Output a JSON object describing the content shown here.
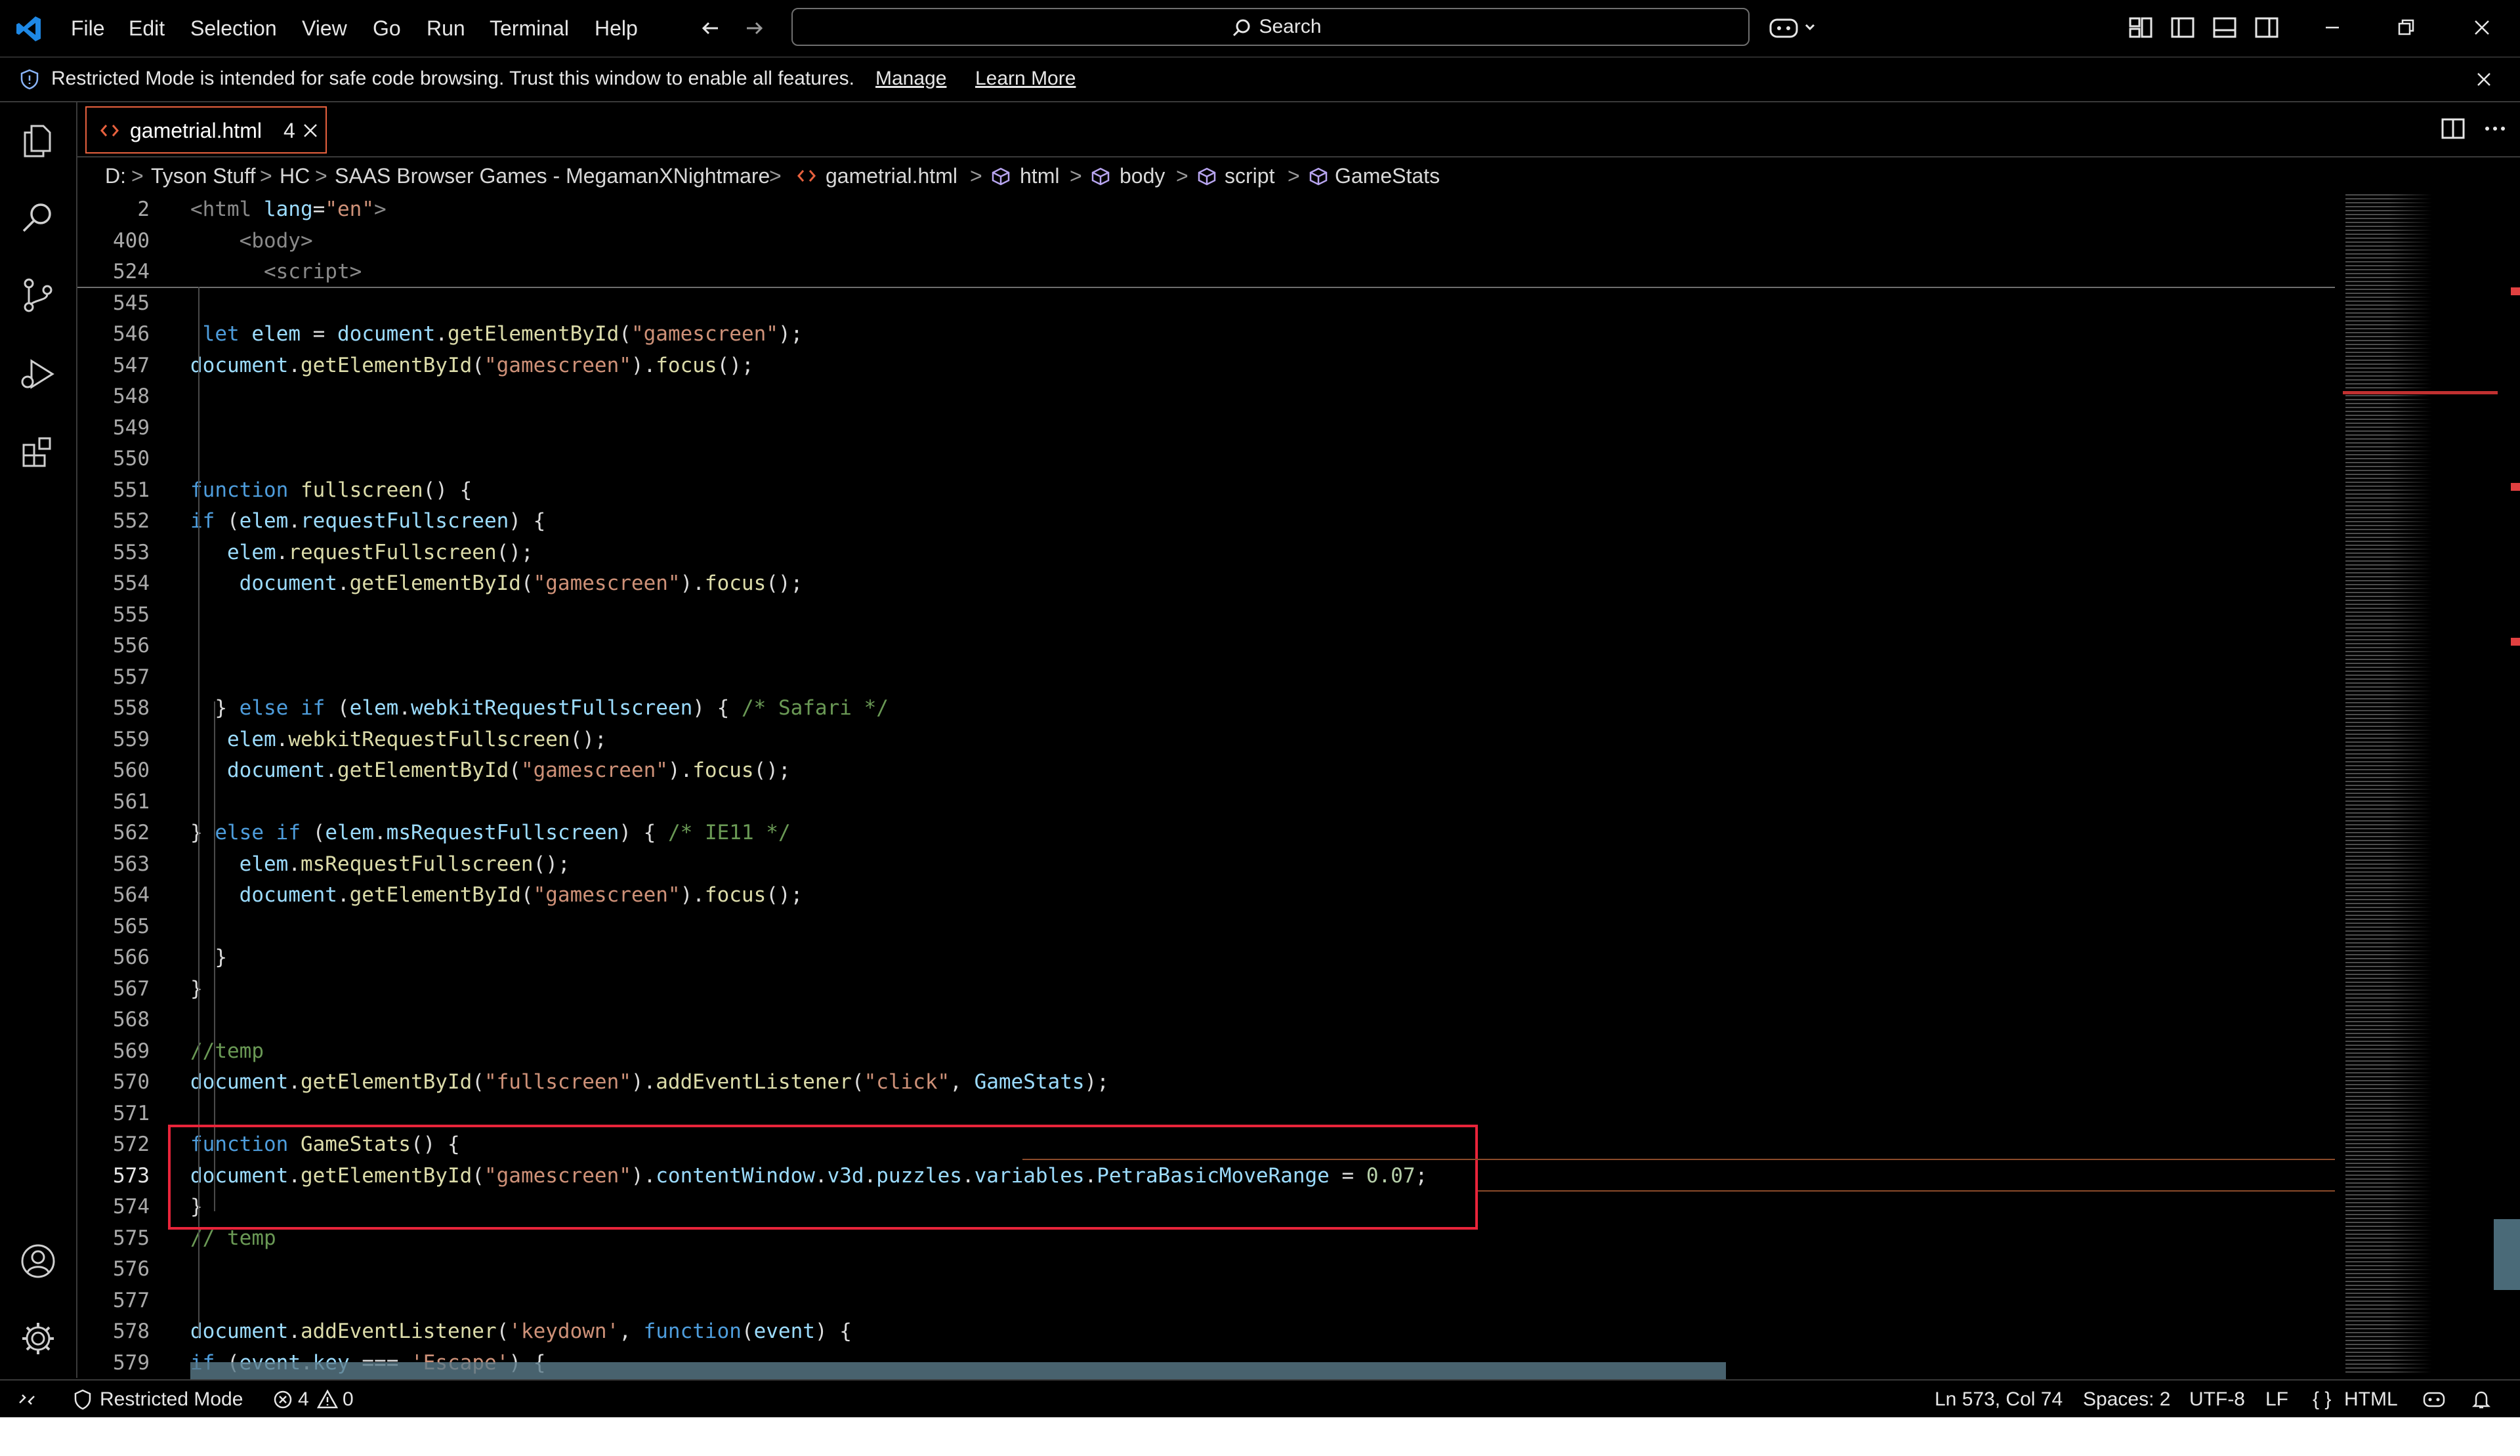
{
  "menu": [
    "File",
    "Edit",
    "Selection",
    "View",
    "Go",
    "Run",
    "Terminal",
    "Help"
  ],
  "search": {
    "label": "Search"
  },
  "banner": {
    "text": "Restricted Mode is intended for safe code browsing. Trust this window to enable all features.",
    "manage": "Manage",
    "learn_more": "Learn More"
  },
  "tab": {
    "filename": "gametrial.html",
    "problem_count": "4"
  },
  "breadcrumb": [
    "D:",
    "Tyson Stuff",
    "HC",
    "SAAS Browser Games - MegamanXNightmare",
    "gametrial.html",
    "html",
    "body",
    "script",
    "GameStats"
  ],
  "editor": {
    "lines": [
      {
        "n": "2",
        "t": "<html lang=\"en\">"
      },
      {
        "n": "400",
        "t": "    <body>"
      },
      {
        "n": "524",
        "t": "      <script>"
      },
      {
        "n": "545",
        "t": ""
      },
      {
        "n": "546",
        "t": " let elem = document.getElementById(\"gamescreen\");"
      },
      {
        "n": "547",
        "t": "document.getElementById(\"gamescreen\").focus();"
      },
      {
        "n": "548",
        "t": ""
      },
      {
        "n": "549",
        "t": ""
      },
      {
        "n": "550",
        "t": ""
      },
      {
        "n": "551",
        "t": "function fullscreen() {"
      },
      {
        "n": "552",
        "t": "if (elem.requestFullscreen) {"
      },
      {
        "n": "553",
        "t": "   elem.requestFullscreen();"
      },
      {
        "n": "554",
        "t": "    document.getElementById(\"gamescreen\").focus();"
      },
      {
        "n": "555",
        "t": ""
      },
      {
        "n": "556",
        "t": ""
      },
      {
        "n": "557",
        "t": ""
      },
      {
        "n": "558",
        "t": "  } else if (elem.webkitRequestFullscreen) { /* Safari */"
      },
      {
        "n": "559",
        "t": "   elem.webkitRequestFullscreen();"
      },
      {
        "n": "560",
        "t": "   document.getElementById(\"gamescreen\").focus();"
      },
      {
        "n": "561",
        "t": ""
      },
      {
        "n": "562",
        "t": "} else if (elem.msRequestFullscreen) { /* IE11 */"
      },
      {
        "n": "563",
        "t": "    elem.msRequestFullscreen();"
      },
      {
        "n": "564",
        "t": "    document.getElementById(\"gamescreen\").focus();"
      },
      {
        "n": "565",
        "t": ""
      },
      {
        "n": "566",
        "t": "  }"
      },
      {
        "n": "567",
        "t": "}"
      },
      {
        "n": "568",
        "t": ""
      },
      {
        "n": "569",
        "t": "//temp"
      },
      {
        "n": "570",
        "t": "document.getElementById(\"fullscreen\").addEventListener(\"click\", GameStats);"
      },
      {
        "n": "571",
        "t": ""
      },
      {
        "n": "572",
        "t": "function GameStats() {"
      },
      {
        "n": "573",
        "t": "document.getElementById(\"gamescreen\").contentWindow.v3d.puzzles.variables.PetraBasicMoveRange = 0.07;"
      },
      {
        "n": "574",
        "t": "}"
      },
      {
        "n": "575",
        "t": "// temp"
      },
      {
        "n": "576",
        "t": ""
      },
      {
        "n": "577",
        "t": ""
      },
      {
        "n": "578",
        "t": "document.addEventListener('keydown', function(event) {"
      },
      {
        "n": "579",
        "t": "if (event.key === 'Escape') {"
      }
    ]
  },
  "status": {
    "restricted": "Restricted Mode",
    "errors": "4",
    "warnings": "0",
    "position": "Ln 573, Col 74",
    "spaces": "Spaces: 2",
    "encoding": "UTF-8",
    "eol": "LF",
    "language": "HTML"
  },
  "colors": {
    "accent_tab": "#e8613e",
    "highlight_box": "#e8243a",
    "vscode_blue": "#1e88e5"
  }
}
